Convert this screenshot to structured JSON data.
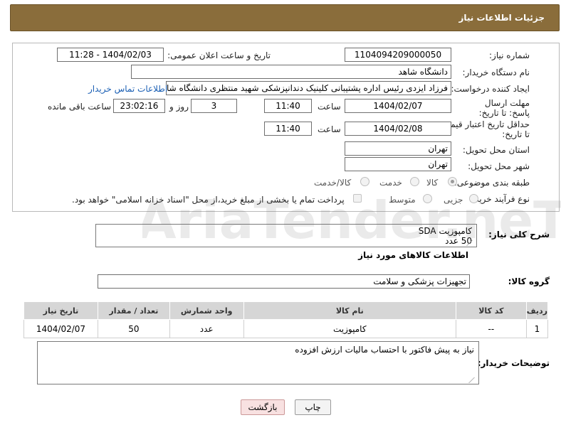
{
  "header": {
    "title": "جزئیات اطلاعات نیاز"
  },
  "form": {
    "need_number_label": "شماره نیاز:",
    "need_number": "1104094209000050",
    "announce_label": "تاریخ و ساعت اعلان عمومی:",
    "announce_value": "1404/02/03 - 11:28",
    "buyer_org_label": "نام دستگاه خریدار:",
    "buyer_org": "دانشگاه شاهد",
    "creator_label": "ایجاد کننده درخواست:",
    "creator": "فرزاد ایزدی رئیس اداره پشتیبانی کلینیک دندانپزشکی شهید منتظری دانشگاه شاهد",
    "contact_link": "اطلاعات تماس خریدار",
    "reply_deadline_label": "مهلت ارسال پاسخ: تا تاریخ:",
    "reply_date": "1404/02/07",
    "time_label": "ساعت",
    "reply_time": "11:40",
    "days": "3",
    "days_label": "روز و",
    "remaining": "23:02:16",
    "remaining_label": "ساعت باقی مانده",
    "price_validity_label": "حداقل تاریخ اعتبار قیمت: تا تاریخ:",
    "price_date": "1404/02/08",
    "price_time": "11:40",
    "province_label": "استان محل تحویل:",
    "province": "تهران",
    "city_label": "شهر محل تحویل:",
    "city": "تهران",
    "category_label": "طبقه بندی موضوعی:",
    "category_options": [
      "کالا",
      "خدمت",
      "کالا/خدمت"
    ],
    "process_label": "نوع فرآیند خرید :",
    "process_options": [
      "جزیی",
      "متوسط"
    ],
    "payment_note": "پرداخت تمام یا بخشی از مبلغ خرید،از محل \"اسناد خزانه اسلامی\" خواهد بود."
  },
  "general": {
    "desc_label": "شرح کلی نیاز:",
    "desc_line1": "کامپوزیت   SDA",
    "desc_line2": "50 عدد",
    "goods_info_title": "اطلاعات کالاهای مورد نیاز",
    "goods_group_label": "گروه کالا:",
    "goods_group": "تجهیزات پزشکی و سلامت"
  },
  "table": {
    "headers": [
      "ردیف",
      "کد کالا",
      "نام کالا",
      "واحد شمارش",
      "تعداد / مقدار",
      "تاریخ نیاز"
    ],
    "rows": [
      [
        "1",
        "--",
        "کامپوزیت",
        "عدد",
        "50",
        "1404/02/07"
      ]
    ]
  },
  "buyer_notes": {
    "label": "توضیحات خریدار:",
    "text": "نیاز به پیش فاکتور با احتساب مالیات ارزش افزوده"
  },
  "buttons": {
    "print": "چاپ",
    "back": "بازگشت"
  },
  "watermark": {
    "text": "AriaTender.neT"
  }
}
